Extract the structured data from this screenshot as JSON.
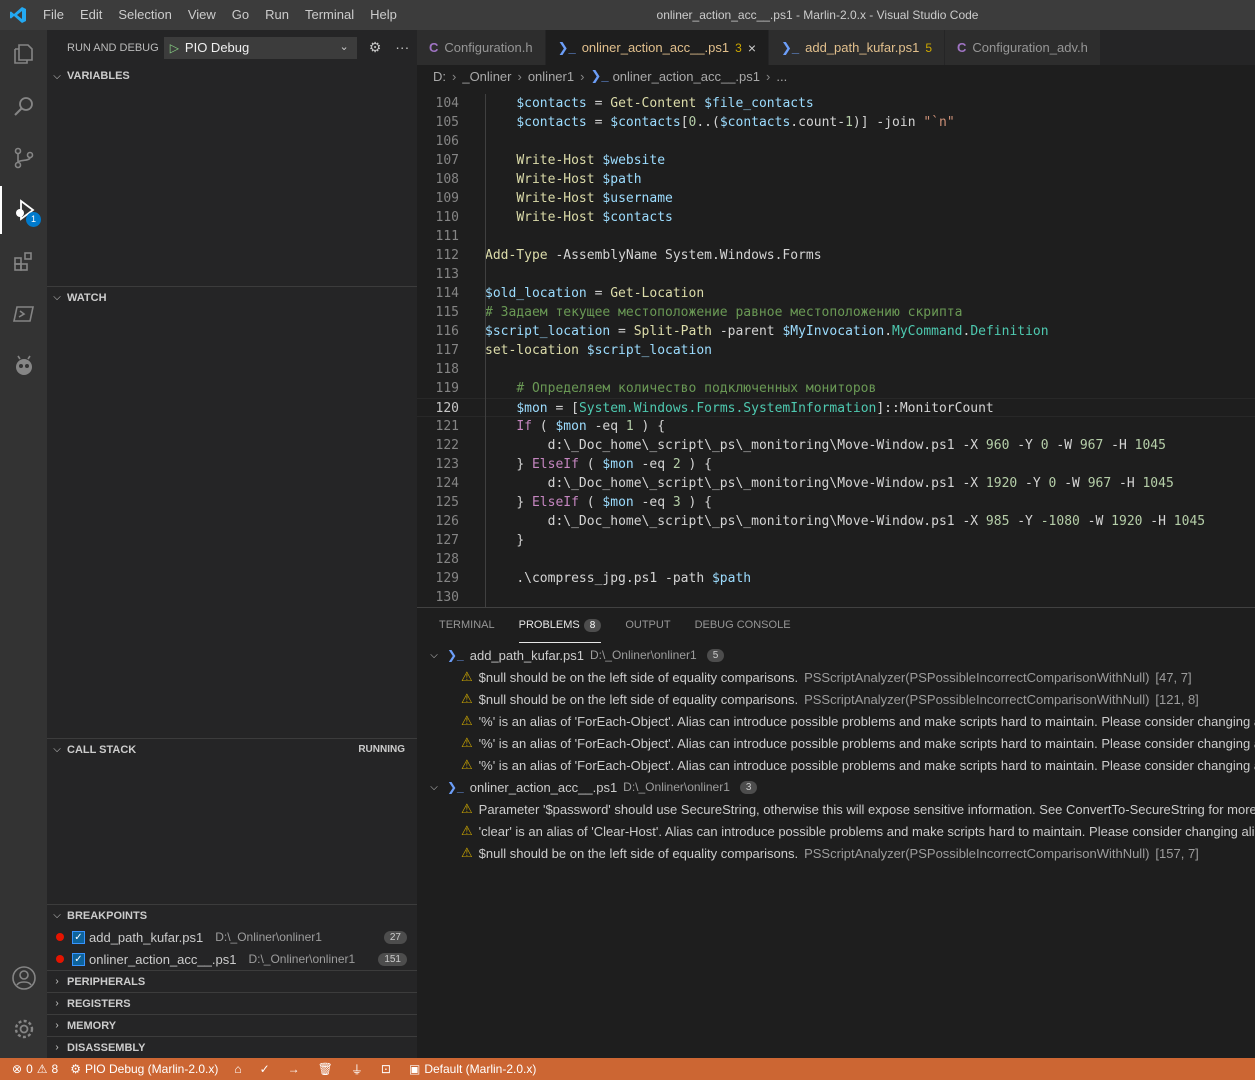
{
  "titlebar": {
    "menu": [
      "File",
      "Edit",
      "Selection",
      "View",
      "Go",
      "Run",
      "Terminal",
      "Help"
    ],
    "title": "onliner_action_acc__.ps1 - Marlin-2.0.x - Visual Studio Code"
  },
  "activity": {
    "debug_badge": "1"
  },
  "sidebar": {
    "header_title": "RUN AND DEBUG",
    "config_name": "PIO Debug",
    "sections": {
      "variables": "VARIABLES",
      "watch": "WATCH",
      "callstack": "CALL STACK",
      "callstack_status": "RUNNING",
      "breakpoints": "BREAKPOINTS",
      "peripherals": "PERIPHERALS",
      "registers": "REGISTERS",
      "memory": "MEMORY",
      "disassembly": "DISASSEMBLY"
    },
    "breakpoints": [
      {
        "name": "add_path_kufar.ps1",
        "path": "D:\\_Onliner\\onliner1",
        "count": "27"
      },
      {
        "name": "onliner_action_acc__.ps1",
        "path": "D:\\_Onliner\\onliner1",
        "count": "151"
      }
    ]
  },
  "tabs": [
    {
      "label": "Configuration.h",
      "icon": "C",
      "num": "",
      "active": false
    },
    {
      "label": "onliner_action_acc__.ps1",
      "icon": ">_",
      "num": "3",
      "active": true
    },
    {
      "label": "add_path_kufar.ps1",
      "icon": ">_",
      "num": "5",
      "active": false
    },
    {
      "label": "Configuration_adv.h",
      "icon": "C",
      "num": "",
      "active": false
    }
  ],
  "breadcrumb": [
    "D:",
    "_Onliner",
    "onliner1",
    "onliner_action_acc__.ps1",
    "..."
  ],
  "editor": {
    "current_line": "120",
    "lines": [
      {
        "n": "104",
        "t": [
          [
            "pl",
            "    "
          ],
          [
            "var",
            "$contacts"
          ],
          [
            "op",
            " = "
          ],
          [
            "cmd",
            "Get-Content"
          ],
          [
            "op",
            " "
          ],
          [
            "var",
            "$file_contacts"
          ]
        ]
      },
      {
        "n": "105",
        "t": [
          [
            "pl",
            "    "
          ],
          [
            "var",
            "$contacts"
          ],
          [
            "op",
            " = "
          ],
          [
            "var",
            "$contacts"
          ],
          [
            "op",
            "["
          ],
          [
            "num",
            "0"
          ],
          [
            "op",
            ".."
          ],
          [
            "op",
            "("
          ],
          [
            "var",
            "$contacts"
          ],
          [
            "op",
            ".count-"
          ],
          [
            "num",
            "1"
          ],
          [
            "op",
            ")] -join "
          ],
          [
            "str",
            "\"`n\""
          ]
        ]
      },
      {
        "n": "106",
        "t": []
      },
      {
        "n": "107",
        "t": [
          [
            "pl",
            "    "
          ],
          [
            "cmd",
            "Write-Host"
          ],
          [
            "op",
            " "
          ],
          [
            "var",
            "$website"
          ]
        ]
      },
      {
        "n": "108",
        "t": [
          [
            "pl",
            "    "
          ],
          [
            "cmd",
            "Write-Host"
          ],
          [
            "op",
            " "
          ],
          [
            "var",
            "$path"
          ]
        ]
      },
      {
        "n": "109",
        "t": [
          [
            "pl",
            "    "
          ],
          [
            "cmd",
            "Write-Host"
          ],
          [
            "op",
            " "
          ],
          [
            "var",
            "$username"
          ]
        ]
      },
      {
        "n": "110",
        "t": [
          [
            "pl",
            "    "
          ],
          [
            "cmd",
            "Write-Host"
          ],
          [
            "op",
            " "
          ],
          [
            "var",
            "$contacts"
          ]
        ]
      },
      {
        "n": "111",
        "t": []
      },
      {
        "n": "112",
        "t": [
          [
            "cmd",
            "Add-Type"
          ],
          [
            "op",
            " -AssemblyName System.Windows.Forms"
          ]
        ]
      },
      {
        "n": "113",
        "t": []
      },
      {
        "n": "114",
        "t": [
          [
            "var",
            "$old_location"
          ],
          [
            "op",
            " = "
          ],
          [
            "cmd",
            "Get-Location"
          ]
        ]
      },
      {
        "n": "115",
        "t": [
          [
            "cm",
            "# Задаем текущее местоположение равное местоположению скрипта"
          ]
        ]
      },
      {
        "n": "116",
        "t": [
          [
            "var",
            "$script_location"
          ],
          [
            "op",
            " = "
          ],
          [
            "cmd",
            "Split-Path"
          ],
          [
            "op",
            " -parent "
          ],
          [
            "var",
            "$MyInvocation"
          ],
          [
            "op",
            "."
          ],
          [
            "ty",
            "MyCommand"
          ],
          [
            "op",
            "."
          ],
          [
            "ty",
            "Definition"
          ]
        ]
      },
      {
        "n": "117",
        "t": [
          [
            "cmd",
            "set-location"
          ],
          [
            "op",
            " "
          ],
          [
            "var",
            "$script_location"
          ]
        ]
      },
      {
        "n": "118",
        "t": []
      },
      {
        "n": "119",
        "t": [
          [
            "pl",
            "    "
          ],
          [
            "cm",
            "# Определяем количество подключенных мониторов"
          ]
        ]
      },
      {
        "n": "120",
        "t": [
          [
            "pl",
            "    "
          ],
          [
            "var",
            "$mon"
          ],
          [
            "op",
            " = "
          ],
          [
            "op",
            "["
          ],
          [
            "ty",
            "System.Windows.Forms.SystemInformation"
          ],
          [
            "op",
            "]::MonitorCount"
          ]
        ]
      },
      {
        "n": "121",
        "t": [
          [
            "pl",
            "    "
          ],
          [
            "kw",
            "If"
          ],
          [
            "op",
            " ( "
          ],
          [
            "var",
            "$mon"
          ],
          [
            "op",
            " -eq "
          ],
          [
            "num",
            "1"
          ],
          [
            "op",
            " ) {"
          ]
        ]
      },
      {
        "n": "122",
        "t": [
          [
            "pl",
            "        "
          ],
          [
            "op",
            "d:\\_Doc_home\\_script\\_ps\\_monitoring\\Move-Window.ps1 -X "
          ],
          [
            "num",
            "960"
          ],
          [
            "op",
            " -Y "
          ],
          [
            "num",
            "0"
          ],
          [
            "op",
            " -W "
          ],
          [
            "num",
            "967"
          ],
          [
            "op",
            " -H "
          ],
          [
            "num",
            "1045"
          ]
        ]
      },
      {
        "n": "123",
        "t": [
          [
            "pl",
            "    "
          ],
          [
            "op",
            "} "
          ],
          [
            "kw",
            "ElseIf"
          ],
          [
            "op",
            " ( "
          ],
          [
            "var",
            "$mon"
          ],
          [
            "op",
            " -eq "
          ],
          [
            "num",
            "2"
          ],
          [
            "op",
            " ) {"
          ]
        ]
      },
      {
        "n": "124",
        "t": [
          [
            "pl",
            "        "
          ],
          [
            "op",
            "d:\\_Doc_home\\_script\\_ps\\_monitoring\\Move-Window.ps1 -X "
          ],
          [
            "num",
            "1920"
          ],
          [
            "op",
            " -Y "
          ],
          [
            "num",
            "0"
          ],
          [
            "op",
            " -W "
          ],
          [
            "num",
            "967"
          ],
          [
            "op",
            " -H "
          ],
          [
            "num",
            "1045"
          ]
        ]
      },
      {
        "n": "125",
        "t": [
          [
            "pl",
            "    "
          ],
          [
            "op",
            "} "
          ],
          [
            "kw",
            "ElseIf"
          ],
          [
            "op",
            " ( "
          ],
          [
            "var",
            "$mon"
          ],
          [
            "op",
            " -eq "
          ],
          [
            "num",
            "3"
          ],
          [
            "op",
            " ) {"
          ]
        ]
      },
      {
        "n": "126",
        "t": [
          [
            "pl",
            "        "
          ],
          [
            "op",
            "d:\\_Doc_home\\_script\\_ps\\_monitoring\\Move-Window.ps1 -X "
          ],
          [
            "num",
            "985"
          ],
          [
            "op",
            " -Y "
          ],
          [
            "num",
            "-1080"
          ],
          [
            "op",
            " -W "
          ],
          [
            "num",
            "1920"
          ],
          [
            "op",
            " -H "
          ],
          [
            "num",
            "1045"
          ]
        ]
      },
      {
        "n": "127",
        "t": [
          [
            "pl",
            "    "
          ],
          [
            "op",
            "}"
          ]
        ]
      },
      {
        "n": "128",
        "t": []
      },
      {
        "n": "129",
        "t": [
          [
            "pl",
            "    "
          ],
          [
            "op",
            ".\\compress_jpg.ps1 -path "
          ],
          [
            "var",
            "$path"
          ]
        ]
      },
      {
        "n": "130",
        "t": []
      }
    ]
  },
  "panel": {
    "tabs": [
      {
        "label": "TERMINAL",
        "active": false,
        "count": ""
      },
      {
        "label": "PROBLEMS",
        "active": true,
        "count": "8"
      },
      {
        "label": "OUTPUT",
        "active": false,
        "count": ""
      },
      {
        "label": "DEBUG CONSOLE",
        "active": false,
        "count": ""
      }
    ],
    "groups": [
      {
        "file": "add_path_kufar.ps1",
        "path": "D:\\_Onliner\\onliner1",
        "count": "5",
        "items": [
          {
            "msg": "$null should be on the left side of equality comparisons.",
            "src": "PSScriptAnalyzer(PSPossibleIncorrectComparisonWithNull)",
            "loc": "[47, 7]"
          },
          {
            "msg": "$null should be on the left side of equality comparisons.",
            "src": "PSScriptAnalyzer(PSPossibleIncorrectComparisonWithNull)",
            "loc": "[121, 8]"
          },
          {
            "msg": "'%' is an alias of 'ForEach-Object'. Alias can introduce possible problems and make scripts hard to maintain. Please consider changing a",
            "src": "",
            "loc": ""
          },
          {
            "msg": "'%' is an alias of 'ForEach-Object'. Alias can introduce possible problems and make scripts hard to maintain. Please consider changing a",
            "src": "",
            "loc": ""
          },
          {
            "msg": "'%' is an alias of 'ForEach-Object'. Alias can introduce possible problems and make scripts hard to maintain. Please consider changing a",
            "src": "",
            "loc": ""
          }
        ]
      },
      {
        "file": "onliner_action_acc__.ps1",
        "path": "D:\\_Onliner\\onliner1",
        "count": "3",
        "items": [
          {
            "msg": "Parameter '$password' should use SecureString, otherwise this will expose sensitive information. See ConvertTo-SecureString for more i",
            "src": "",
            "loc": ""
          },
          {
            "msg": "'clear' is an alias of 'Clear-Host'. Alias can introduce possible problems and make scripts hard to maintain. Please consider changing alia",
            "src": "",
            "loc": ""
          },
          {
            "msg": "$null should be on the left side of equality comparisons.",
            "src": "PSScriptAnalyzer(PSPossibleIncorrectComparisonWithNull)",
            "loc": "[157, 7]"
          }
        ]
      }
    ]
  },
  "statusbar": {
    "errors": "0",
    "warnings": "8",
    "debug_label": "PIO Debug (Marlin-2.0.x)",
    "env_label": "Default (Marlin-2.0.x)"
  }
}
